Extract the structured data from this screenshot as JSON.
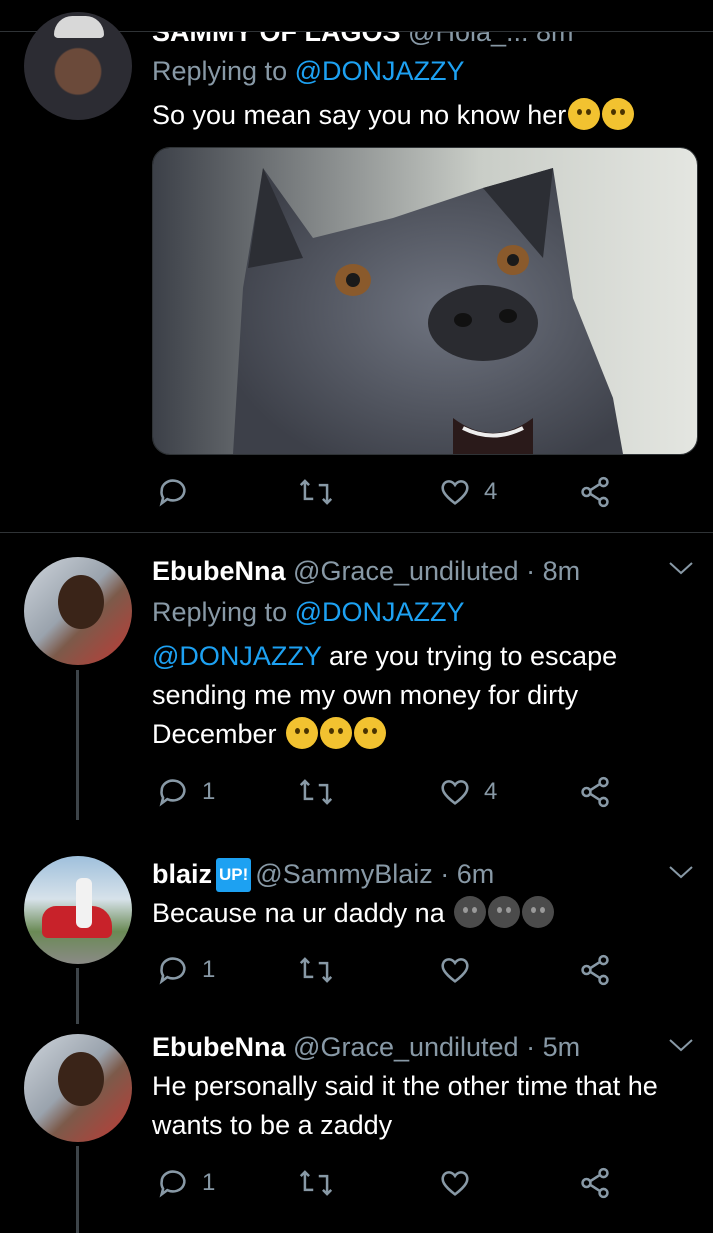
{
  "tweets": [
    {
      "name": "SAMMY OF LAGOS",
      "handle": "@Hola_...",
      "time": "8m",
      "replying_prefix": "Replying to",
      "replying_handle": "@DONJAZZY",
      "text": "So you mean say you no know her",
      "emojis": [
        "confused-face",
        "confused-face"
      ],
      "media": "dog-photo",
      "likes": "4"
    },
    {
      "name": "EbubeNna",
      "handle": "@Grace_undiluted",
      "time": "· 8m",
      "replying_prefix": "Replying to",
      "replying_handle": "@DONJAZZY",
      "mention": "@DONJAZZY",
      "text": " are you trying to escape sending me my own money for dirty December",
      "emojis": [
        "eye-roll-face",
        "eye-roll-face",
        "eye-roll-face"
      ],
      "replies": "1",
      "likes": "4"
    },
    {
      "name": "blaiz",
      "badge": "UP!",
      "handle": "@SammyBlaiz",
      "time": "· 6m",
      "text": "Because na ur daddy na",
      "emojis": [
        "smirk-face",
        "smirk-face",
        "smirk-face"
      ],
      "replies": "1"
    },
    {
      "name": "EbubeNna",
      "handle": "@Grace_undiluted",
      "time": "· 5m",
      "text": "He personally said it the other time that he wants to be a zaddy",
      "replies": "1"
    }
  ],
  "colors": {
    "background": "#000000",
    "muted": "#8899a6",
    "accent": "#1da1f2",
    "divider": "#2f3336"
  },
  "icons": [
    "reply-icon",
    "retweet-icon",
    "like-icon",
    "share-icon",
    "chevron-down-icon"
  ]
}
